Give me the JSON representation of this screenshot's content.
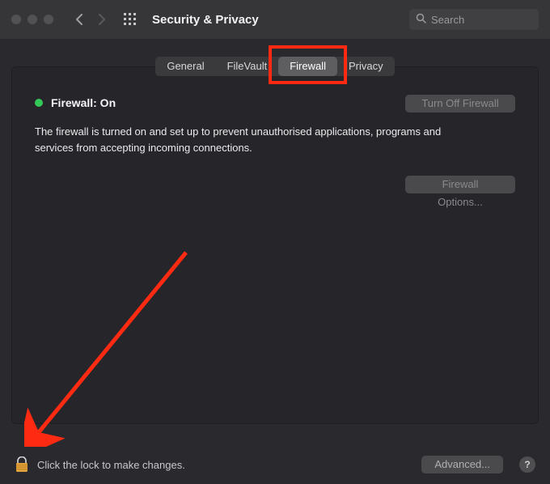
{
  "window": {
    "title": "Security & Privacy",
    "search_placeholder": "Search"
  },
  "tabs": [
    {
      "label": "General"
    },
    {
      "label": "FileVault"
    },
    {
      "label": "Firewall"
    },
    {
      "label": "Privacy"
    }
  ],
  "firewall": {
    "status_label": "Firewall: On",
    "status_color": "#34c759",
    "turn_off_label": "Turn Off Firewall",
    "options_label": "Firewall Options...",
    "description": "The firewall is turned on and set up to prevent unauthorised applications, programs and services from accepting incoming connections."
  },
  "footer": {
    "lock_text": "Click the lock to make changes.",
    "advanced_label": "Advanced...",
    "help_label": "?"
  },
  "annotation": {
    "highlight_tab_index": 2,
    "arrow_color": "#ff2a12"
  }
}
